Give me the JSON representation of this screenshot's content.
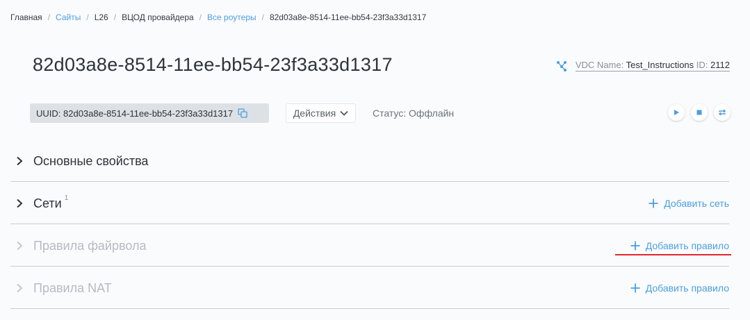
{
  "breadcrumb": {
    "items": [
      {
        "label": "Главная"
      },
      {
        "label": "Сайты"
      },
      {
        "label": "L26"
      },
      {
        "label": "ВЦОД провайдера"
      },
      {
        "label": "Все роутеры"
      },
      {
        "label": "82d03a8e-8514-11ee-bb54-23f3a33d1317"
      }
    ],
    "separator": "/"
  },
  "header": {
    "title": "82d03a8e-8514-11ee-bb54-23f3a33d1317",
    "vdc": {
      "icon": "topology-icon",
      "name_label": "VDC Name:",
      "name_value": "Test_Instructions",
      "id_label": "ID:",
      "id_value": "2112"
    }
  },
  "toolbar": {
    "uuid_text": "UUID: 82d03a8e-8514-11ee-bb54-23f3a33d1317",
    "actions_label": "Действия",
    "status_text": "Статус: Оффлайн",
    "controls": [
      "play-icon",
      "stop-icon",
      "restart-icon"
    ]
  },
  "sections": [
    {
      "title": "Основные свойства"
    },
    {
      "title": "Сети",
      "count": "1",
      "add_label": "Добавить сеть"
    },
    {
      "title": "Правила файрвола",
      "add_label": "Добавить правило"
    },
    {
      "title": "Правила NAT",
      "add_label": "Добавить правило"
    }
  ],
  "colors": {
    "accent": "#4a9fe0",
    "highlight": "#e0262d",
    "chip_bg": "#dde1e5"
  }
}
